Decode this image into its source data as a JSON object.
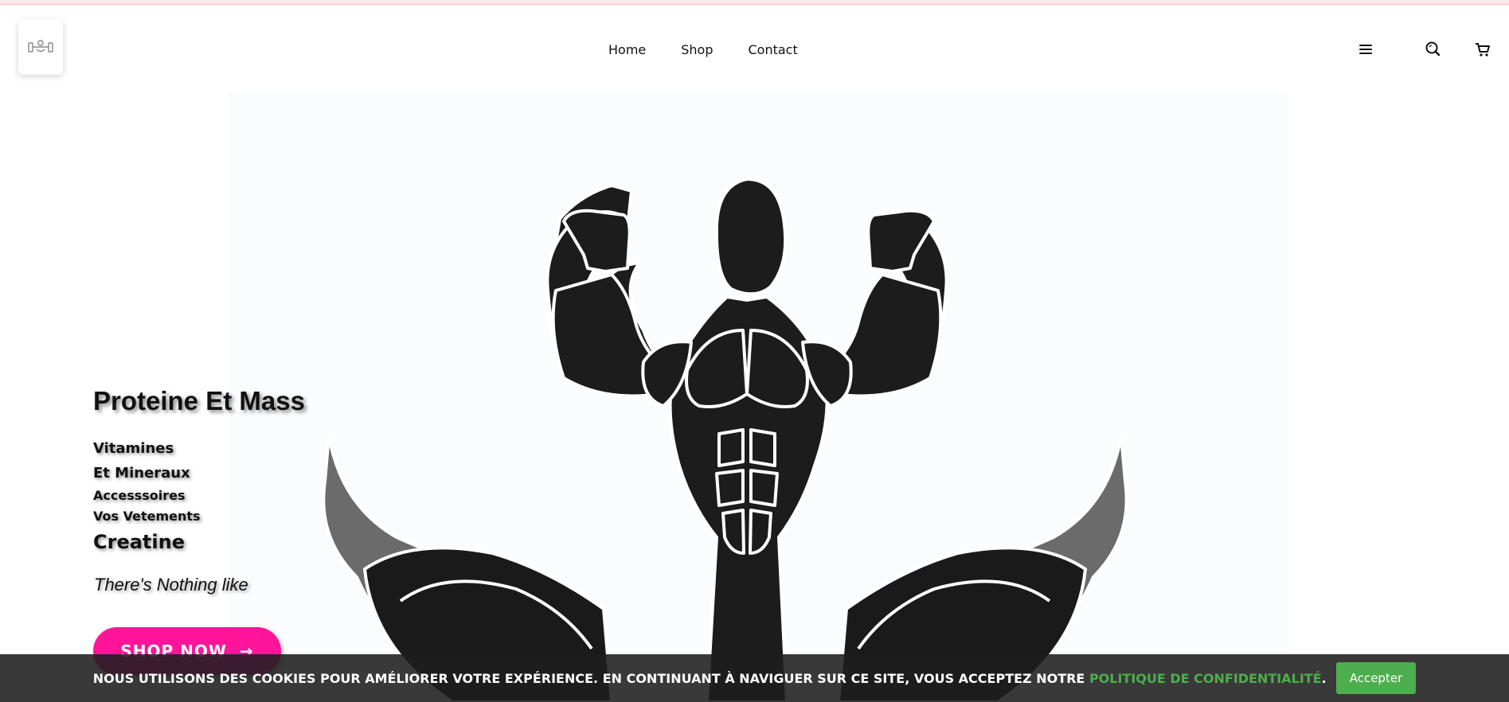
{
  "nav": {
    "items": [
      {
        "label": "Home"
      },
      {
        "label": "Shop"
      },
      {
        "label": "Contact"
      }
    ]
  },
  "header_icons": [
    "menu-icon",
    "search-icon",
    "cart-icon"
  ],
  "hero": {
    "title": "Proteine Et Mass",
    "lines": [
      "Vitamines",
      "Et Mineraux",
      "Accesssoires",
      "Vos Vetements",
      "Creatine"
    ],
    "tagline": "There's Nothing like",
    "button_label": "SHOP NOW",
    "button_arrow": "→",
    "image": "bodybuilder-flexing-silhouette"
  },
  "cookie": {
    "text": "NOUS UTILISONS DES COOKIES POUR AMÉLIORER VOTRE EXPÉRIENCE. EN CONTINUANT À NAVIGUER SUR CE SITE, VOUS ACCEPTEZ NOTRE ",
    "link": "POLITIQUE DE CONFIDENTIALITÉ",
    "suffix": ".",
    "accept_label": "Accepter"
  },
  "colors": {
    "accent_pink": "#ff149a",
    "accept_green": "#4cae4c",
    "cookie_bar": "#1e1e1e"
  }
}
